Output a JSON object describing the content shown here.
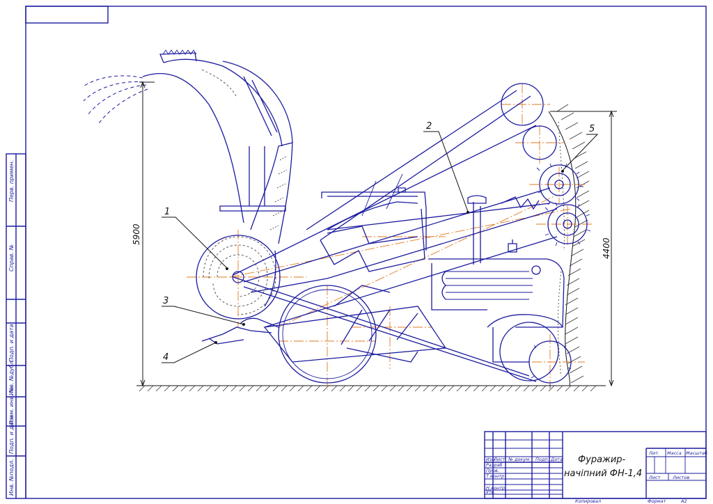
{
  "drawing": {
    "callouts": [
      "1",
      "2",
      "3",
      "4",
      "5"
    ],
    "dimensions": {
      "left_height": "5900",
      "right_height": "4400"
    }
  },
  "side_stamp": {
    "perv_primen": "Перв. примен.",
    "sprav_no": "Справ. №",
    "podp_data_1": "Подп. и дата",
    "inv_dubl": "Инв. №дубл.",
    "vzam_inv": "Взам. инв. №",
    "podp_data_2": "Подп. и дата",
    "inv_podl": "Инв. №подл."
  },
  "title_block": {
    "title_line1": "Фуражир-",
    "title_line2": "начіпний ФН-1,4",
    "col_izm": "Изм",
    "col_list": "Лист",
    "col_docum": "№ докум.",
    "col_podp": "Подп.",
    "col_data": "Дата",
    "row_razrab": "Разраб",
    "row_prov": "Пров.",
    "row_tkontr": "Т.контр",
    "row_nkontr": "Н.контр",
    "row_utv": "Утв.",
    "lit": "Лит.",
    "massa": "Масса",
    "masshtab": "Масштаб",
    "list": "Лист",
    "listov": "Листов",
    "kopiroval": "Копировал",
    "format": "Формат",
    "format_value": "А2"
  }
}
